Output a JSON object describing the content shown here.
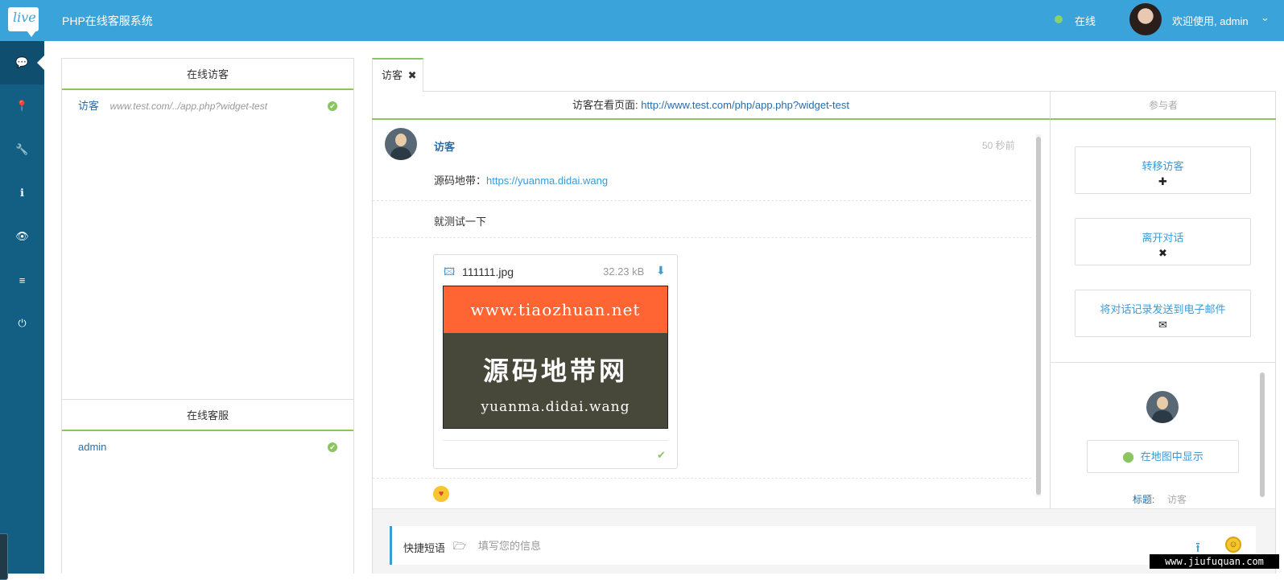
{
  "app": {
    "logo_text": "live",
    "title": "PHP在线客服系统",
    "status": "在线",
    "welcome": "欢迎使用, admin",
    "colors": {
      "topbar": "#3aa3da",
      "sidebar": "#135f84",
      "accent_green": "#8ac560",
      "link_blue": "#2a6da8"
    }
  },
  "sidebar": {
    "items": [
      {
        "icon": "chat-icon",
        "glyph": "💬"
      },
      {
        "icon": "map-marker-icon",
        "glyph": "📍"
      },
      {
        "icon": "wrench-icon",
        "glyph": "🔧"
      },
      {
        "icon": "info-icon",
        "glyph": "ℹ"
      },
      {
        "icon": "eye-icon",
        "glyph": "👁"
      },
      {
        "icon": "list-icon",
        "glyph": "≡"
      },
      {
        "icon": "power-icon",
        "glyph": "⏻"
      }
    ]
  },
  "visitors_panel": {
    "title": "在线访客",
    "items": [
      {
        "name": "访客",
        "url": "www.test.com/../app.php?widget-test"
      }
    ]
  },
  "operators_panel": {
    "title": "在线客服",
    "items": [
      {
        "name": "admin"
      }
    ]
  },
  "chat": {
    "tab_label": "访客",
    "viewing_label": "访客在看页面:",
    "viewing_url": "http://www.test.com/php/app.php?widget-test",
    "participants_label": "参与者",
    "message": {
      "author": "访客",
      "time": "50 秒前",
      "line1_prefix": "源码地带：",
      "line1_link": "https://yuanma.didai.wang",
      "line2": "就测试一下"
    },
    "file": {
      "name": "111111.jpg",
      "size": "32.23 kB",
      "image_top_text": "www.tiaozhuan.net",
      "image_big_text": "源码地带网",
      "image_small_text": "yuanma.didai.wang"
    }
  },
  "actions": [
    {
      "label": "转移访客",
      "icon_glyph": "✚"
    },
    {
      "label": "离开对话",
      "icon_glyph": "✖"
    },
    {
      "label": "将对话记录发送到电子邮件",
      "icon_glyph": "✉"
    }
  ],
  "visitor_info": {
    "map_button": "在地图中显示",
    "title_label": "标题:",
    "title_value": "访客"
  },
  "composer": {
    "quick_replies": "快捷短语",
    "placeholder": "填写您的信息"
  },
  "watermark": "www.jiufuquan.com"
}
